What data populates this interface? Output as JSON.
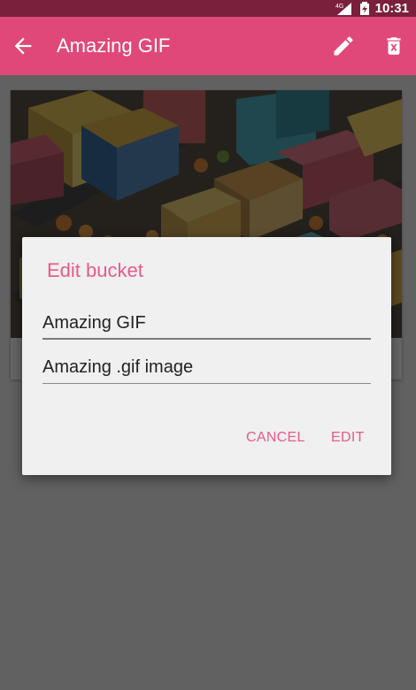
{
  "status_bar": {
    "network_label": "4G",
    "time": "10:31"
  },
  "app_bar": {
    "title": "Amazing GIF",
    "back_icon": "arrow-left-icon",
    "edit_icon": "pencil-icon",
    "delete_icon": "trash-icon"
  },
  "card": {
    "image_icon": "isometric-city-image",
    "caption": ""
  },
  "dialog": {
    "title": "Edit bucket",
    "name_value": "Amazing GIF",
    "description_value": "Amazing .gif image",
    "cancel_label": "CANCEL",
    "edit_label": "EDIT"
  },
  "colors": {
    "status_bar": "#7a1f3c",
    "app_bar": "#e0487a",
    "accent": "#e85a8a",
    "dialog_bg": "#f0f0f0"
  }
}
